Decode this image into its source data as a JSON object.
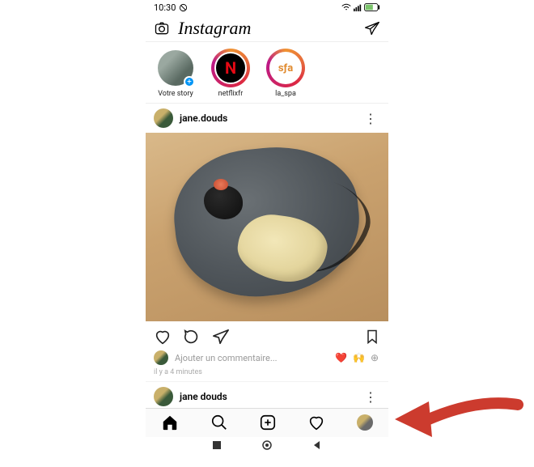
{
  "status": {
    "time": "10:30",
    "dnd_icon": "dnd-icon"
  },
  "header": {
    "logo_text": "Instagram"
  },
  "stories": [
    {
      "label": "Votre story",
      "has_ring": false,
      "avatar_bg": "linear-gradient(135deg,#8aa 40%,#556 60%)",
      "badge": "+"
    },
    {
      "label": "netflixfr",
      "has_ring": true,
      "avatar_bg": "#000",
      "avatar_letter": "N",
      "letter_color": "#e50914"
    },
    {
      "label": "la_spa",
      "has_ring": true,
      "avatar_bg": "#fff",
      "avatar_letter": "sƒa",
      "letter_color": "#e08a2e"
    }
  ],
  "post": {
    "username": "jane.douds",
    "comment_placeholder": "Ajouter un commentaire...",
    "quick_emojis": "❤️ 🙌 ⊕",
    "time_text": "il y a 4 minutes"
  },
  "next_post": {
    "username": "jane douds"
  },
  "nav": {
    "items": [
      "home",
      "search",
      "create",
      "activity",
      "profile"
    ]
  }
}
